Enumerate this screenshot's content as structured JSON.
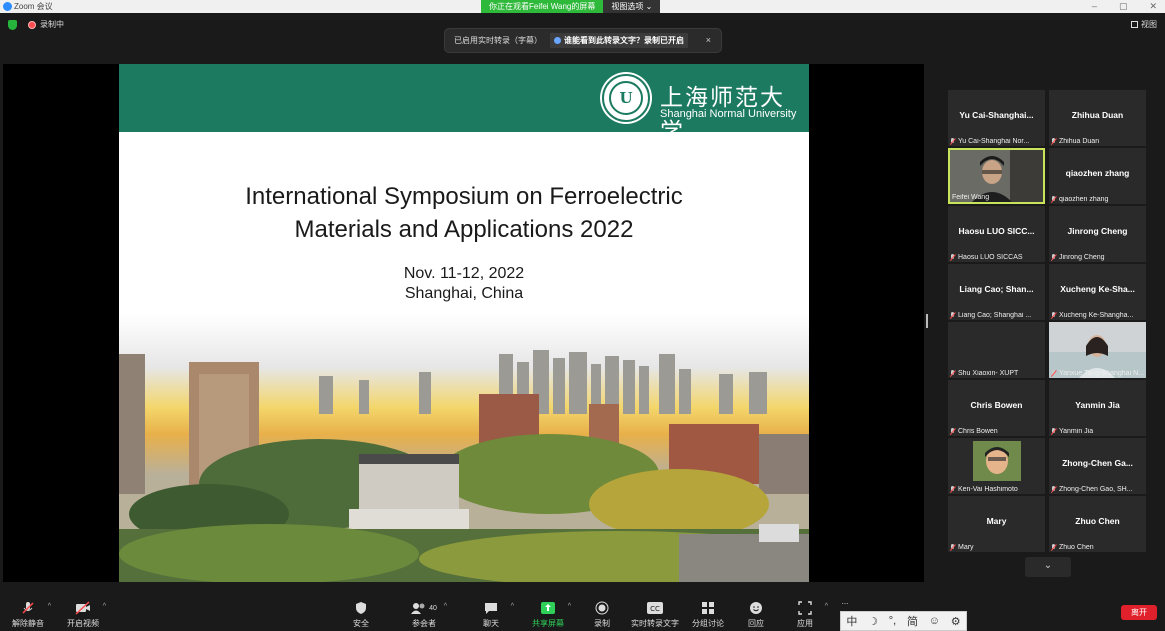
{
  "window": {
    "title": "Zoom 会议",
    "controls": [
      "–",
      "▢",
      "✕"
    ]
  },
  "viewing_banner": {
    "text": "你正在观看Feifei Wang的屏幕",
    "options_label": "视图选项 ⌄"
  },
  "status": {
    "recording_label": "录制中",
    "view_label": "视图"
  },
  "toast": {
    "text": "已启用实时转录（字幕）",
    "question": "谁能看到此转录文字？录制已开启",
    "close": "×"
  },
  "slide": {
    "university_cn": "上海师范大学",
    "university_en": "Shanghai Normal University",
    "logo_glyph": "U",
    "title_line1": "International Symposium on Ferroelectric",
    "title_line2": "Materials and Applications 2022",
    "date": "Nov. 11-12, 2022",
    "location": "Shanghai, China"
  },
  "participants": [
    {
      "display": "Yu  Cai-Shanghai...",
      "label": "Yu Cai-Shanghai Nor...",
      "video": false
    },
    {
      "display": "Zhihua Duan",
      "label": "Zhihua Duan",
      "video": false
    },
    {
      "display": "",
      "label": "Feifei Wang",
      "video": true,
      "active": true
    },
    {
      "display": "qiaozhen zhang",
      "label": "qiaozhen zhang",
      "video": false
    },
    {
      "display": "Haosu  LUO SICC...",
      "label": "Haosu LUO SICCAS",
      "video": false
    },
    {
      "display": "Jinrong Cheng",
      "label": "Jinrong Cheng",
      "video": false
    },
    {
      "display": "Liang Cao;  Shan...",
      "label": "Liang Cao; Shanghai ...",
      "video": false
    },
    {
      "display": "Xucheng  Ke-Sha...",
      "label": "Xucheng Ke-Shangha...",
      "video": false
    },
    {
      "display": "",
      "label": "Shu Xiaoxin- XUPT",
      "video": false
    },
    {
      "display": "",
      "label": "Yanxue Tang-Shanghai N...",
      "video": true
    },
    {
      "display": "Chris Bowen",
      "label": "Chris Bowen",
      "video": false
    },
    {
      "display": "Yanmin Jia",
      "label": "Yanmin Jia",
      "video": false
    },
    {
      "display": "",
      "label": "Ken-Vai Hashimoto",
      "video": true
    },
    {
      "display": "Zhong-Chen  Ga...",
      "label": "Zhong-Chen Gao, SH...",
      "video": false
    },
    {
      "display": "Mary",
      "label": "Mary",
      "video": false
    },
    {
      "display": "Zhuo Chen",
      "label": "Zhuo Chen",
      "video": false
    }
  ],
  "toolbar": {
    "unmute": "解除静音",
    "start_video": "开启视频",
    "security": "安全",
    "participants": "参会者",
    "participants_count": "40",
    "chat": "聊天",
    "share": "共享屏幕",
    "record": "录制",
    "transcript": "实时转录文字",
    "breakout": "分组讨论",
    "reactions": "回应",
    "apps": "应用",
    "more": "...",
    "end": "离开"
  },
  "ime": {
    "items": [
      "中",
      "☽",
      "°,",
      "简",
      "☺",
      "⚙"
    ]
  },
  "colors": {
    "header_green": "#1c7a60",
    "share_green": "#2fd05a",
    "end_red": "#e0212b",
    "active_border": "#c8e45a"
  }
}
